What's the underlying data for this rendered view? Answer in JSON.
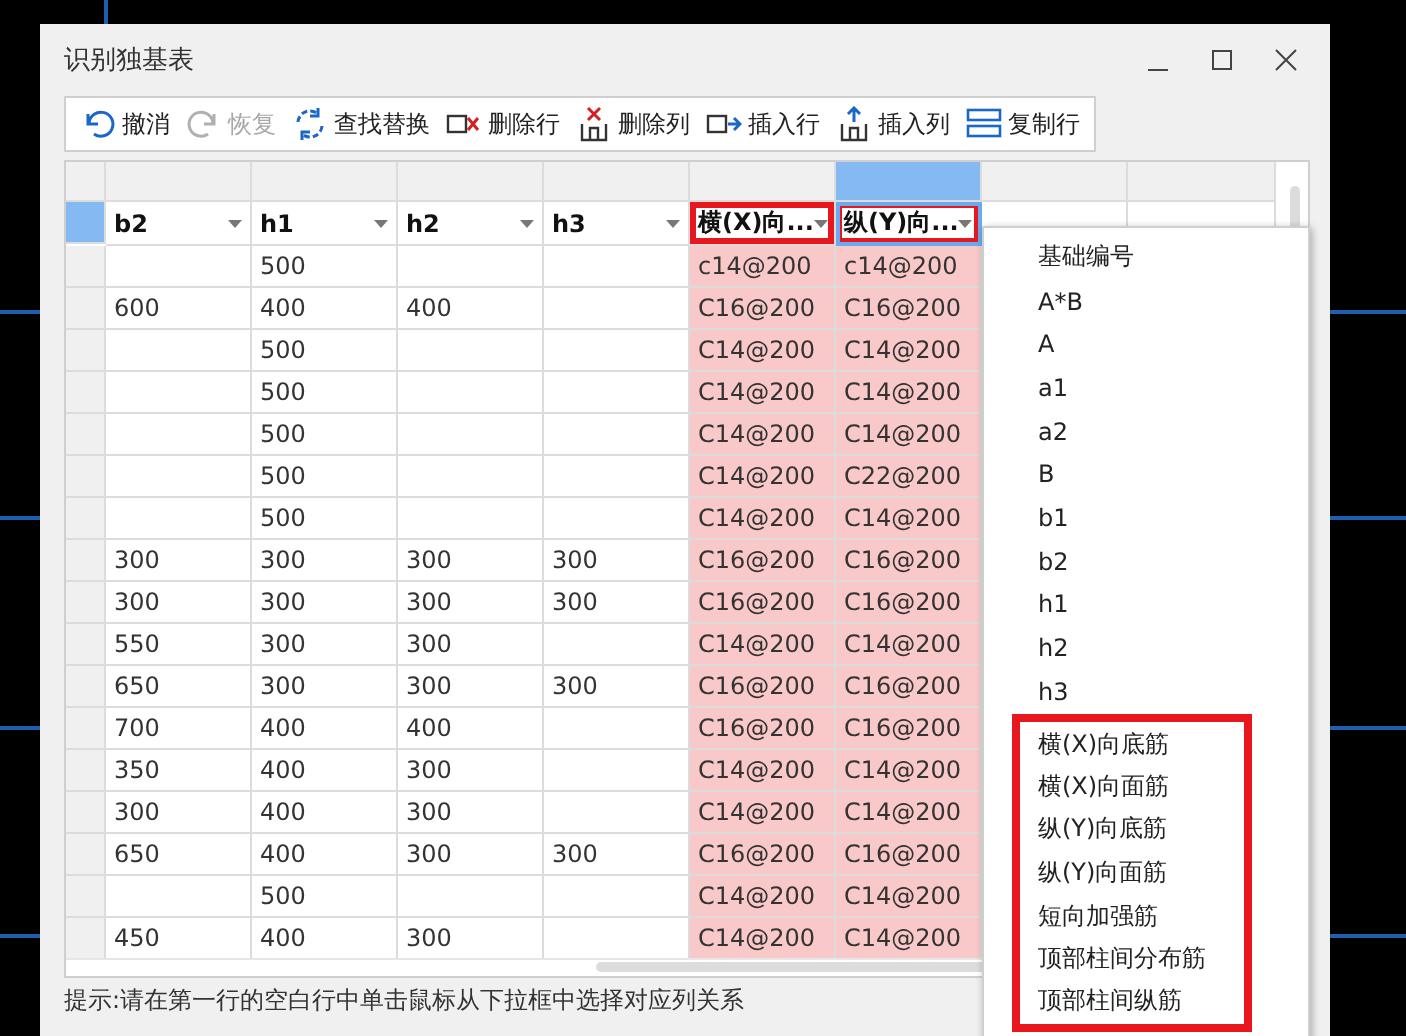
{
  "window": {
    "title": "识别独基表"
  },
  "toolbar": [
    {
      "kind": "undo",
      "label": "撤消",
      "disabled": false
    },
    {
      "kind": "redo",
      "label": "恢复",
      "disabled": true
    },
    {
      "kind": "replace",
      "label": "查找替换",
      "disabled": false
    },
    {
      "kind": "delete-row",
      "label": "删除行",
      "disabled": false
    },
    {
      "kind": "delete-col",
      "label": "删除列",
      "disabled": false
    },
    {
      "kind": "insert-row",
      "label": "插入行",
      "disabled": false
    },
    {
      "kind": "insert-col",
      "label": "插入列",
      "disabled": false
    },
    {
      "kind": "copy-row",
      "label": "复制行",
      "disabled": false
    }
  ],
  "table": {
    "columns": [
      {
        "label": "b2",
        "highlighted": false,
        "selected": false
      },
      {
        "label": "h1",
        "highlighted": false,
        "selected": false
      },
      {
        "label": "h2",
        "highlighted": false,
        "selected": false
      },
      {
        "label": "h3",
        "highlighted": false,
        "selected": false
      },
      {
        "label": "横(X)向...",
        "highlighted": true,
        "selected": false
      },
      {
        "label": "纵(Y)向...",
        "highlighted": true,
        "selected": true
      }
    ],
    "rows": [
      [
        null,
        "500",
        null,
        null,
        "c14@200",
        "c14@200"
      ],
      [
        "600",
        "400",
        "400",
        null,
        "C16@200",
        "C16@200"
      ],
      [
        null,
        "500",
        null,
        null,
        "C14@200",
        "C14@200"
      ],
      [
        null,
        "500",
        null,
        null,
        "C14@200",
        "C14@200"
      ],
      [
        null,
        "500",
        null,
        null,
        "C14@200",
        "C14@200"
      ],
      [
        null,
        "500",
        null,
        null,
        "C14@200",
        "C22@200"
      ],
      [
        null,
        "500",
        null,
        null,
        "C14@200",
        "C14@200"
      ],
      [
        "300",
        "300",
        "300",
        "300",
        "C16@200",
        "C16@200"
      ],
      [
        "300",
        "300",
        "300",
        "300",
        "C16@200",
        "C16@200"
      ],
      [
        "550",
        "300",
        "300",
        null,
        "C14@200",
        "C14@200"
      ],
      [
        "650",
        "300",
        "300",
        "300",
        "C16@200",
        "C16@200"
      ],
      [
        "700",
        "400",
        "400",
        null,
        "C16@200",
        "C16@200"
      ],
      [
        "350",
        "400",
        "300",
        null,
        "C14@200",
        "C14@200"
      ],
      [
        "300",
        "400",
        "300",
        null,
        "C14@200",
        "C14@200"
      ],
      [
        "650",
        "400",
        "300",
        "300",
        "C16@200",
        "C16@200"
      ],
      [
        null,
        "500",
        null,
        null,
        "C14@200",
        "C14@200"
      ],
      [
        "450",
        "400",
        "300",
        null,
        "C14@200",
        "C14@200"
      ]
    ]
  },
  "dropdown": {
    "items": [
      {
        "label": "基础编号",
        "highlighted": false
      },
      {
        "label": "A*B",
        "highlighted": false
      },
      {
        "label": "A",
        "highlighted": false
      },
      {
        "label": "a1",
        "highlighted": false
      },
      {
        "label": "a2",
        "highlighted": false
      },
      {
        "label": "B",
        "highlighted": false
      },
      {
        "label": "b1",
        "highlighted": false
      },
      {
        "label": "b2",
        "highlighted": false
      },
      {
        "label": "h1",
        "highlighted": false
      },
      {
        "label": "h2",
        "highlighted": false
      },
      {
        "label": "h3",
        "highlighted": false
      },
      {
        "label": "横(X)向底筋",
        "highlighted": true
      },
      {
        "label": "横(X)向面筋",
        "highlighted": true
      },
      {
        "label": "纵(Y)向底筋",
        "highlighted": true
      },
      {
        "label": "纵(Y)向面筋",
        "highlighted": true
      },
      {
        "label": "短向加强筋",
        "highlighted": true
      },
      {
        "label": "顶部柱间分布筋",
        "highlighted": true
      },
      {
        "label": "顶部柱间纵筋",
        "highlighted": true
      }
    ]
  },
  "hint": "提示:请在第一行的空白行中单击鼠标从下拉框中选择对应列关系"
}
